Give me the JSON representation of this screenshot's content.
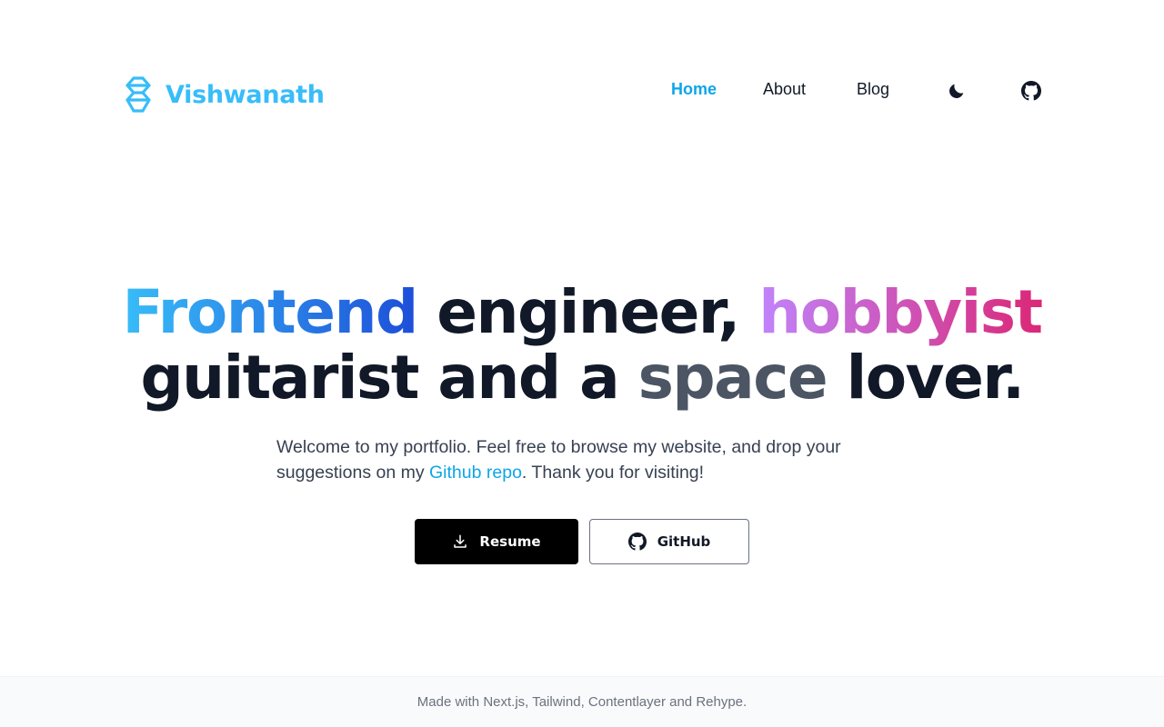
{
  "brand": {
    "name": "Vishwanath",
    "color": "#38bdf8"
  },
  "nav": {
    "items": [
      {
        "label": "Home",
        "active": true
      },
      {
        "label": "About",
        "active": false
      },
      {
        "label": "Blog",
        "active": false
      }
    ],
    "icons": [
      "moon-icon",
      "github-icon"
    ]
  },
  "hero": {
    "line1": {
      "word1": "Frontend",
      "word2": "engineer,",
      "word3": "hobbyist"
    },
    "line2": {
      "word1": "guitarist and a",
      "word2": "space",
      "word3": "lover."
    },
    "intro_before": "Welcome to my portfolio. Feel free to browse my website, and drop your suggestions on my ",
    "intro_link": "Github repo",
    "intro_after": ". Thank you for visiting!"
  },
  "buttons": {
    "resume": {
      "label": "Resume",
      "icon": "download-icon"
    },
    "github": {
      "label": "GitHub",
      "icon": "github-icon"
    }
  },
  "footer": {
    "text": "Made with Next.js, Tailwind, Contentlayer and Rehype."
  },
  "colors": {
    "accent": "#0ea5e9",
    "gradient_blue": [
      "#38bdf8",
      "#1d4ed8"
    ],
    "gradient_pink": [
      "#c084fc",
      "#db2777"
    ]
  }
}
